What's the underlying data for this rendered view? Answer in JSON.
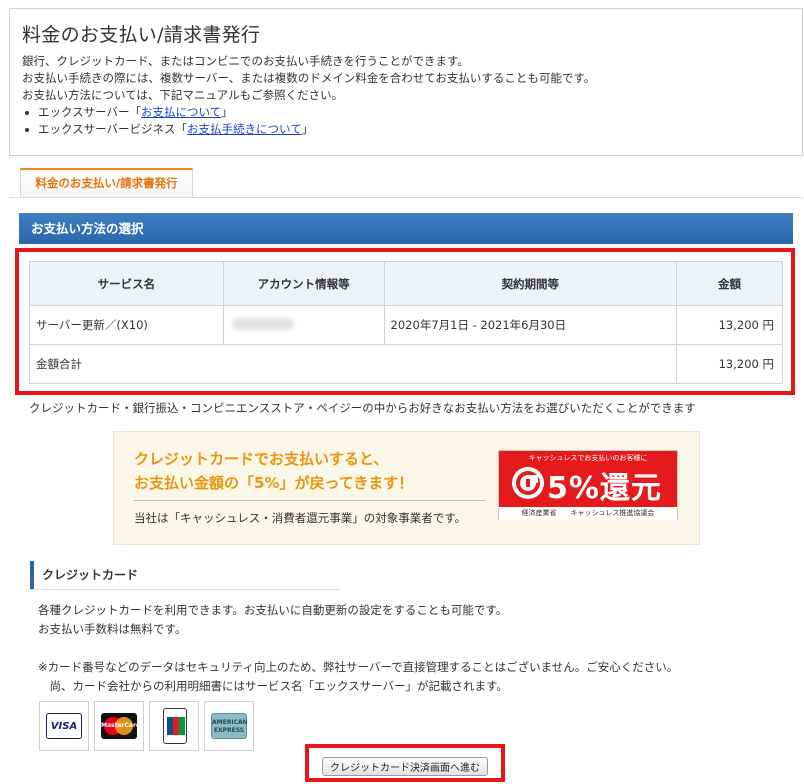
{
  "page": {
    "title": "料金のお支払い/請求書発行",
    "intro": [
      "銀行、クレジットカード、またはコンビニでのお支払い手続きを行うことができます。",
      "お支払い手続きの際には、複数サーバー、または複数のドメイン料金を合わせてお支払いすることも可能です。",
      "お支払い方法については、下記マニュアルもご参照ください。"
    ],
    "links": [
      {
        "prefix": "エックスサーバー「",
        "text": "お支払について",
        "suffix": "」"
      },
      {
        "prefix": "エックスサーバービジネス「",
        "text": "お支払手続きについて",
        "suffix": "」"
      }
    ]
  },
  "tab": {
    "label": "料金のお支払い/請求書発行"
  },
  "section": {
    "title": "お支払い方法の選択"
  },
  "table": {
    "headers": [
      "サービス名",
      "アカウント情報等",
      "契約期間等",
      "金額"
    ],
    "row": {
      "service": "サーバー更新／(X10)",
      "account": "",
      "period": "2020年7月1日 - 2021年6月30日",
      "amount": "13,200 円"
    },
    "total": {
      "label": "金額合計",
      "amount": "13,200 円"
    }
  },
  "method_note": "クレジットカード・銀行振込・コンビニエンスストア・ペイジーの中からお好きなお支払い方法をお選びいただくことができます",
  "banner": {
    "line1": "クレジットカードでお支払いすると、",
    "line2": "お支払い金額の「5%」が戻ってきます！",
    "line3": "当社は「キャッシュレス・消費者還元事業」の対象事業者です。",
    "badge_top": "キャッシュレスでお支払いのお客様に",
    "badge_big": "5%還元",
    "badge_bottom": "経済産業省　　キャッシュレス推進協議会"
  },
  "credit": {
    "title": "クレジットカード",
    "lines": [
      "各種クレジットカードを利用できます。お支払いに自動更新の設定をすることも可能です。",
      "お支払い手数料は無料です。",
      "",
      "※カード番号などのデータはセキュリティ向上のため、弊社サーバーで直接管理することはございません。ご安心ください。",
      "　尚、カード会社からの利用明細書にはサービス名「エックスサーバー」が記載されます。"
    ],
    "cards": {
      "visa": "VISA",
      "master": "MasterCard",
      "jcb": "JCB",
      "amex": "AMERICAN EXPRESS"
    },
    "button": "クレジットカード決済画面へ進む"
  },
  "colors": {
    "accent_blue": "#2a66aa",
    "highlight_red": "#e8141a",
    "tab_orange": "#e8730c",
    "banner_orange": "#e8960e"
  }
}
